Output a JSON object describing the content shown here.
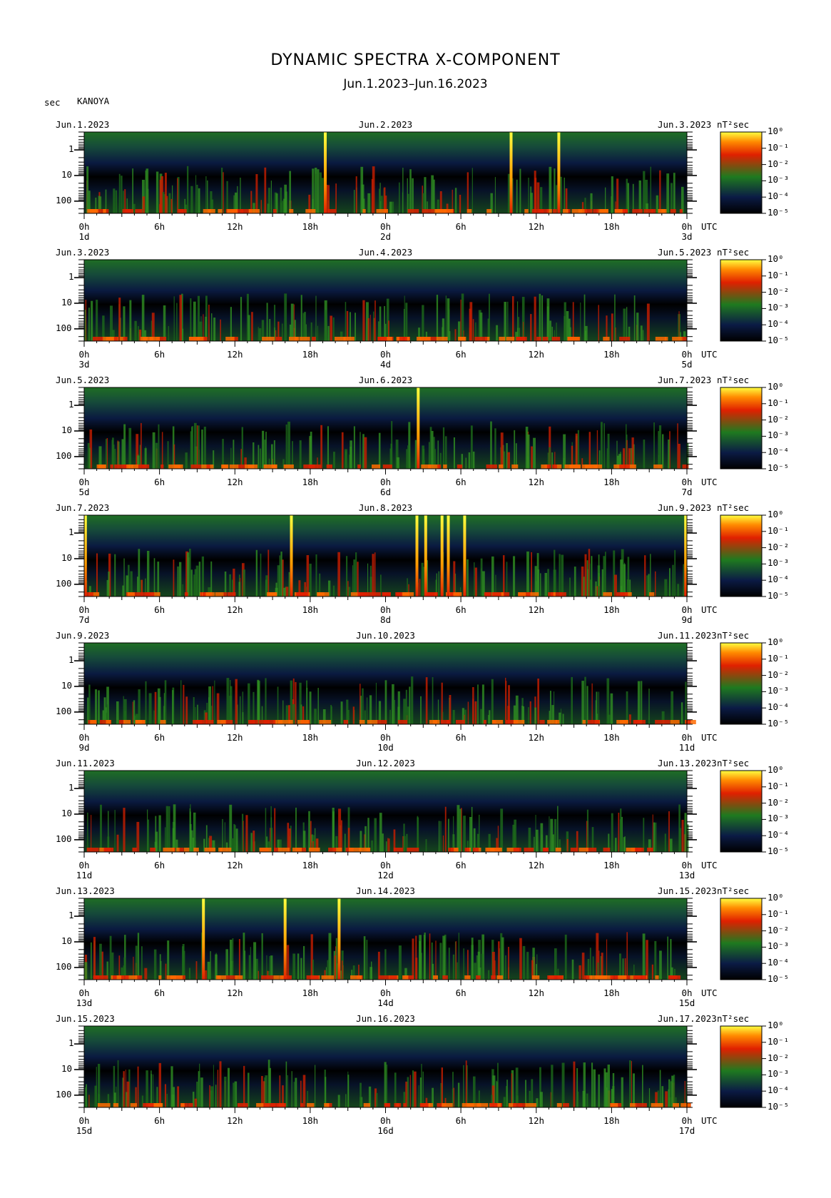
{
  "title": "DYNAMIC SPECTRA X-COMPONENT",
  "subtitle": "Jun.1.2023–Jun.16.2023",
  "y_unit": "sec",
  "station": "KANOYA",
  "colorbar_unit": "nT²sec",
  "time_zone_label": "UTC",
  "y_tick_labels": [
    "1",
    "10",
    "100"
  ],
  "x_tick_labels": [
    "0h",
    "6h",
    "12h",
    "18h",
    "0h",
    "6h",
    "12h",
    "18h",
    "0h"
  ],
  "colorbar_tick_labels": [
    "10⁰",
    "10⁻¹",
    "10⁻²",
    "10⁻³",
    "10⁻⁴",
    "10⁻⁵"
  ],
  "colors": {
    "background": "#000000",
    "quiet": "#0a1a3a",
    "medium": "#1f7a1f",
    "strong": "#e02000",
    "peak": "#ffff30"
  },
  "chart_data": [
    {
      "type": "heatmap",
      "start_label": "Jun.1.2023",
      "mid_label": "Jun.2.2023",
      "end_label": "Jun.3.2023",
      "day_labels": [
        "1d",
        "2d",
        "3d"
      ],
      "yscale": "log",
      "ylim": [
        300,
        0.2
      ],
      "spikes_hours": [
        19.2,
        34.0,
        37.8
      ]
    },
    {
      "type": "heatmap",
      "start_label": "Jun.3.2023",
      "mid_label": "Jun.4.2023",
      "end_label": "Jun.5.2023",
      "day_labels": [
        "3d",
        "4d",
        "5d"
      ],
      "yscale": "log",
      "ylim": [
        300,
        0.2
      ],
      "spikes_hours": []
    },
    {
      "type": "heatmap",
      "start_label": "Jun.5.2023",
      "mid_label": "Jun.6.2023",
      "end_label": "Jun.7.2023",
      "day_labels": [
        "5d",
        "6d",
        "7d"
      ],
      "yscale": "log",
      "ylim": [
        300,
        0.2
      ],
      "spikes_hours": [
        26.6
      ]
    },
    {
      "type": "heatmap",
      "start_label": "Jun.7.2023",
      "mid_label": "Jun.8.2023",
      "end_label": "Jun.9.2023",
      "day_labels": [
        "7d",
        "8d",
        "9d"
      ],
      "yscale": "log",
      "ylim": [
        300,
        0.2
      ],
      "spikes_hours": [
        0.1,
        16.5,
        26.5,
        27.2,
        28.5,
        29.0,
        30.3,
        47.9
      ]
    },
    {
      "type": "heatmap",
      "start_label": "Jun.9.2023",
      "mid_label": "Jun.10.2023",
      "end_label": "Jun.11.2023",
      "day_labels": [
        "9d",
        "10d",
        "11d"
      ],
      "yscale": "log",
      "ylim": [
        300,
        0.2
      ],
      "spikes_hours": []
    },
    {
      "type": "heatmap",
      "start_label": "Jun.11.2023",
      "mid_label": "Jun.12.2023",
      "end_label": "Jun.13.2023",
      "day_labels": [
        "11d",
        "12d",
        "13d"
      ],
      "yscale": "log",
      "ylim": [
        300,
        0.2
      ],
      "spikes_hours": []
    },
    {
      "type": "heatmap",
      "start_label": "Jun.13.2023",
      "mid_label": "Jun.14.2023",
      "end_label": "Jun.15.2023",
      "day_labels": [
        "13d",
        "14d",
        "15d"
      ],
      "yscale": "log",
      "ylim": [
        300,
        0.2
      ],
      "spikes_hours": [
        9.5,
        16.0,
        20.3
      ]
    },
    {
      "type": "heatmap",
      "start_label": "Jun.15.2023",
      "mid_label": "Jun.16.2023",
      "end_label": "Jun.17.2023",
      "day_labels": [
        "15d",
        "16d",
        "17d"
      ],
      "yscale": "log",
      "ylim": [
        300,
        0.2
      ],
      "spikes_hours": []
    }
  ]
}
